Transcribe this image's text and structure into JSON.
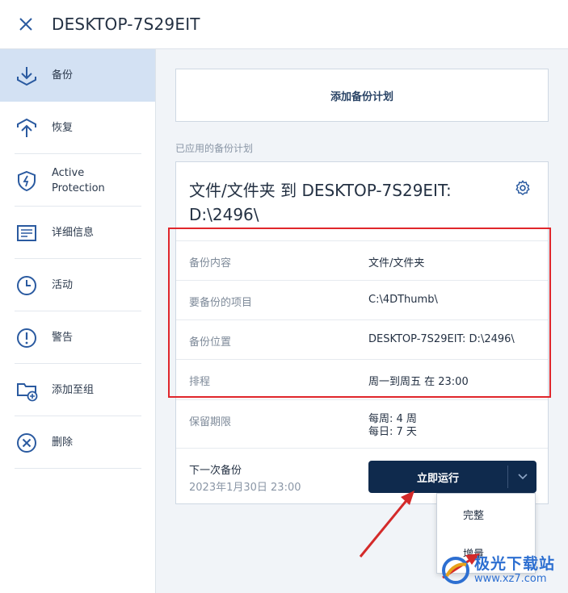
{
  "header": {
    "title": "DESKTOP-7S29EIT"
  },
  "sidebar": {
    "items": [
      {
        "label": "备份",
        "icon": "backup-icon",
        "active": true
      },
      {
        "label": "恢复",
        "icon": "recovery-icon",
        "active": false
      },
      {
        "label": "Active Protection",
        "icon": "shield-icon",
        "active": false
      },
      {
        "label": "详细信息",
        "icon": "details-icon",
        "active": false
      },
      {
        "label": "活动",
        "icon": "clock-icon",
        "active": false
      },
      {
        "label": "警告",
        "icon": "alert-icon",
        "active": false
      },
      {
        "label": "添加至组",
        "icon": "folder-add-icon",
        "active": false
      },
      {
        "label": "删除",
        "icon": "delete-icon",
        "active": false
      }
    ]
  },
  "main": {
    "add_plan_label": "添加备份计划",
    "applied_label": "已应用的备份计划",
    "card": {
      "title": "文件/文件夹 到 DESKTOP-7S29EIT: D:\\2496\\",
      "rows": [
        {
          "key": "备份内容",
          "value": "文件/文件夹"
        },
        {
          "key": "要备份的项目",
          "value": "C:\\4DThumb\\"
        },
        {
          "key": "备份位置",
          "value": "DESKTOP-7S29EIT: D:\\2496\\"
        },
        {
          "key": "排程",
          "value": "周一到周五 在 23:00"
        }
      ],
      "retention": {
        "key": "保留期限",
        "line1": "每周: 4 周",
        "line2": "每日: 7 天"
      },
      "next_backup": {
        "label": "下一次备份",
        "time": "2023年1月30日 23:00"
      },
      "run_button": "立即运行"
    },
    "dropdown": {
      "items": [
        "完整",
        "增量"
      ]
    }
  },
  "watermark": {
    "line1": "极光下载站",
    "line2": "www.xz7.com"
  },
  "colors": {
    "accent": "#0f2a4d",
    "active_bg": "#d3e1f3",
    "highlight": "#e0262b",
    "icon": "#2a5aa0"
  }
}
